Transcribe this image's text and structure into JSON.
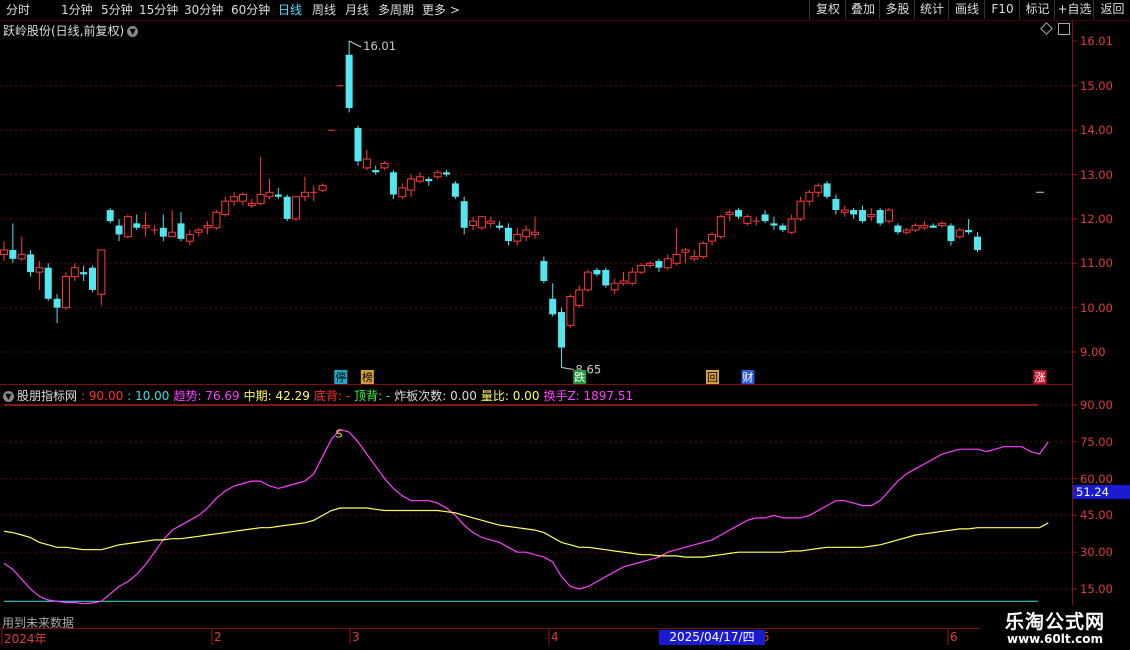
{
  "toolbar": {
    "left": [
      "分时",
      "1分钟",
      "5分钟",
      "15分钟",
      "30分钟",
      "60分钟",
      "日线",
      "周线",
      "月线",
      "多周期",
      "更多 >"
    ],
    "active": "日线",
    "right": [
      "复权",
      "叠加",
      "多股",
      "统计",
      "画线",
      "F10",
      "标记",
      "+自选",
      "返回"
    ]
  },
  "stock_header": {
    "title": "跃岭股份(日线,前复权)"
  },
  "price_axis": {
    "ticks": [
      "16.01",
      "15.00",
      "14.00",
      "13.00",
      "12.00",
      "11.00",
      "10.00",
      "9.00"
    ]
  },
  "annotations": {
    "high_label": "16.01",
    "low_label": "8.65",
    "markers": [
      {
        "label": "停",
        "color": "#1fa9c9",
        "text_color": "#000"
      },
      {
        "label": "榜",
        "color": "#d9a23a",
        "text_color": "#000"
      },
      {
        "label": "跌",
        "color": "#1f9a3a",
        "text_color": "#fff"
      },
      {
        "label": "回",
        "color": "#d9a23a",
        "text_color": "#000"
      },
      {
        "label": "财",
        "color": "#2a5bd8",
        "text_color": "#fff"
      },
      {
        "label": "涨",
        "color": "#c0162a",
        "text_color": "#fff"
      }
    ]
  },
  "indicator_header": {
    "name": "股朋指标网",
    "items": [
      {
        "text": ": 90.00",
        "color": "#ff3030"
      },
      {
        "text": ": 10.00",
        "color": "#40e0e0"
      },
      {
        "text": "趋势: 76.69",
        "color": "#ff40ff"
      },
      {
        "text": "中期: 42.29",
        "color": "#ffff60"
      },
      {
        "text": "底背: -",
        "color": "#ff3030"
      },
      {
        "text": "顶背: -",
        "color": "#40ff40"
      },
      {
        "text": "炸板次数: 0.00",
        "color": "#dddddd"
      },
      {
        "text": "量比: 0.00",
        "color": "#ffff60"
      },
      {
        "text": "换手Z: 1897.51",
        "color": "#ff40ff"
      }
    ]
  },
  "indicator_axis": {
    "ticks": [
      "90.00",
      "75.00",
      "60.00",
      "45.00",
      "30.00",
      "15.00"
    ]
  },
  "indicator_current_value": "51.24",
  "signal_label": "S",
  "future_note": "用到未来数据",
  "x_axis": {
    "labels": [
      "2024年",
      "2",
      "3",
      "4",
      "5",
      "6"
    ],
    "cursor_date": "2025/04/17/四"
  },
  "watermark": {
    "line1": "乐淘公式网",
    "line2": "www.60lt.com"
  },
  "chart_data": [
    {
      "type": "candlestick",
      "title": "跃岭股份(日线,前复权)",
      "ylim": [
        8.6,
        16.3
      ],
      "up_color": "#ff3a3a",
      "down_color": "#54e6f0",
      "ohlc": [
        [
          11.2,
          11.5,
          11.05,
          11.3
        ],
        [
          11.3,
          11.9,
          11.0,
          11.1
        ],
        [
          11.1,
          11.6,
          11.05,
          11.2
        ],
        [
          11.2,
          11.3,
          10.7,
          10.8
        ],
        [
          10.8,
          11.05,
          10.4,
          10.9
        ],
        [
          10.9,
          11.0,
          10.15,
          10.2
        ],
        [
          10.2,
          10.3,
          9.65,
          10.0
        ],
        [
          10.0,
          10.8,
          9.95,
          10.7
        ],
        [
          10.7,
          11.0,
          10.6,
          10.9
        ],
        [
          10.8,
          10.95,
          10.6,
          10.75
        ],
        [
          10.9,
          10.95,
          10.35,
          10.4
        ],
        [
          10.3,
          11.3,
          10.05,
          11.3
        ],
        [
          12.2,
          12.25,
          11.9,
          11.95
        ],
        [
          11.85,
          12.0,
          11.5,
          11.65
        ],
        [
          11.6,
          12.1,
          11.55,
          12.05
        ],
        [
          11.9,
          12.1,
          11.75,
          11.8
        ],
        [
          11.8,
          12.15,
          11.6,
          11.85
        ],
        [
          11.75,
          11.85,
          11.65,
          11.75
        ],
        [
          11.8,
          12.1,
          11.5,
          11.6
        ],
        [
          11.6,
          12.2,
          11.65,
          11.7
        ],
        [
          11.9,
          12.15,
          11.5,
          11.55
        ],
        [
          11.5,
          11.75,
          11.4,
          11.65
        ],
        [
          11.7,
          11.8,
          11.6,
          11.75
        ],
        [
          11.8,
          11.95,
          11.65,
          11.85
        ],
        [
          11.8,
          12.2,
          11.75,
          12.15
        ],
        [
          12.1,
          12.5,
          12.05,
          12.4
        ],
        [
          12.4,
          12.6,
          12.3,
          12.5
        ],
        [
          12.4,
          12.6,
          12.3,
          12.55
        ],
        [
          12.3,
          12.45,
          12.25,
          12.35
        ],
        [
          12.35,
          13.4,
          12.3,
          12.55
        ],
        [
          12.5,
          12.9,
          12.45,
          12.6
        ],
        [
          12.55,
          12.7,
          12.45,
          12.5
        ],
        [
          12.5,
          12.55,
          11.95,
          12.0
        ],
        [
          12.0,
          12.5,
          11.95,
          12.5
        ],
        [
          12.5,
          12.95,
          12.4,
          12.6
        ],
        [
          12.6,
          12.75,
          12.4,
          12.6
        ],
        [
          12.65,
          12.8,
          12.6,
          12.75
        ],
        [
          14.0,
          14.0,
          14.0,
          14.0
        ],
        [
          15.0,
          15.0,
          15.0,
          15.0
        ],
        [
          15.7,
          16.01,
          14.4,
          14.5
        ],
        [
          14.05,
          14.1,
          13.2,
          13.3
        ],
        [
          13.15,
          13.55,
          13.1,
          13.35
        ],
        [
          13.1,
          13.2,
          13.0,
          13.05
        ],
        [
          13.15,
          13.3,
          13.1,
          13.25
        ],
        [
          13.05,
          13.1,
          12.45,
          12.55
        ],
        [
          12.5,
          12.8,
          12.45,
          12.7
        ],
        [
          12.65,
          13.0,
          12.5,
          12.9
        ],
        [
          12.85,
          13.05,
          12.8,
          12.95
        ],
        [
          12.9,
          12.95,
          12.75,
          12.85
        ],
        [
          12.95,
          13.1,
          12.9,
          13.05
        ],
        [
          13.05,
          13.1,
          12.95,
          13.0
        ],
        [
          12.8,
          12.85,
          12.45,
          12.5
        ],
        [
          12.4,
          12.5,
          11.65,
          11.8
        ],
        [
          11.85,
          12.05,
          11.75,
          11.95
        ],
        [
          11.8,
          12.0,
          11.75,
          12.05
        ],
        [
          11.9,
          12.05,
          11.8,
          11.95
        ],
        [
          11.85,
          11.95,
          11.75,
          11.8
        ],
        [
          11.8,
          11.9,
          11.4,
          11.5
        ],
        [
          11.5,
          11.8,
          11.4,
          11.65
        ],
        [
          11.6,
          11.85,
          11.5,
          11.75
        ],
        [
          11.65,
          12.05,
          11.55,
          11.7
        ],
        [
          11.05,
          11.15,
          10.55,
          10.6
        ],
        [
          10.2,
          10.55,
          9.8,
          9.85
        ],
        [
          9.9,
          10.0,
          8.65,
          9.1
        ],
        [
          9.6,
          10.3,
          9.55,
          10.25
        ],
        [
          10.05,
          10.5,
          10.0,
          10.4
        ],
        [
          10.4,
          10.85,
          10.35,
          10.8
        ],
        [
          10.85,
          10.9,
          10.7,
          10.75
        ],
        [
          10.85,
          10.9,
          10.45,
          10.5
        ],
        [
          10.4,
          10.65,
          10.3,
          10.55
        ],
        [
          10.55,
          10.8,
          10.5,
          10.6
        ],
        [
          10.55,
          10.9,
          10.5,
          10.8
        ],
        [
          10.8,
          11.0,
          10.75,
          10.95
        ],
        [
          10.95,
          11.05,
          10.9,
          11.0
        ],
        [
          11.05,
          11.1,
          10.8,
          10.9
        ],
        [
          10.9,
          11.2,
          10.85,
          11.1
        ],
        [
          11.0,
          11.8,
          10.95,
          11.2
        ],
        [
          11.25,
          11.35,
          11.0,
          11.3
        ],
        [
          11.1,
          11.3,
          11.05,
          11.15
        ],
        [
          11.15,
          11.5,
          11.1,
          11.45
        ],
        [
          11.5,
          11.7,
          11.4,
          11.65
        ],
        [
          11.6,
          12.1,
          11.55,
          12.05
        ],
        [
          12.1,
          12.2,
          11.95,
          12.15
        ],
        [
          12.2,
          12.25,
          12.0,
          12.05
        ],
        [
          11.9,
          12.1,
          11.85,
          12.05
        ],
        [
          11.95,
          12.05,
          11.85,
          11.95
        ],
        [
          12.1,
          12.2,
          11.9,
          11.95
        ],
        [
          11.9,
          12.05,
          11.75,
          11.85
        ],
        [
          11.85,
          11.9,
          11.7,
          11.75
        ],
        [
          11.7,
          12.1,
          11.65,
          12.0
        ],
        [
          12.0,
          12.5,
          11.95,
          12.4
        ],
        [
          12.4,
          12.65,
          12.3,
          12.6
        ],
        [
          12.6,
          12.8,
          12.5,
          12.75
        ],
        [
          12.8,
          12.85,
          12.45,
          12.5
        ],
        [
          12.45,
          12.55,
          12.1,
          12.2
        ],
        [
          12.15,
          12.3,
          12.05,
          12.2
        ],
        [
          12.2,
          12.25,
          12.0,
          12.1
        ],
        [
          12.2,
          12.3,
          11.9,
          11.95
        ],
        [
          12.05,
          12.25,
          11.95,
          12.1
        ],
        [
          12.2,
          12.25,
          11.85,
          11.9
        ],
        [
          11.95,
          12.25,
          11.9,
          12.2
        ],
        [
          11.85,
          11.9,
          11.65,
          11.7
        ],
        [
          11.7,
          11.8,
          11.65,
          11.75
        ],
        [
          11.75,
          11.9,
          11.7,
          11.85
        ],
        [
          11.8,
          11.95,
          11.75,
          11.85
        ],
        [
          11.85,
          11.9,
          11.8,
          11.8
        ],
        [
          11.85,
          11.95,
          11.8,
          11.9
        ],
        [
          11.85,
          11.9,
          11.4,
          11.5
        ],
        [
          11.6,
          11.8,
          11.55,
          11.75
        ],
        [
          11.75,
          12.0,
          11.65,
          11.7
        ],
        [
          11.6,
          11.7,
          11.25,
          11.3
        ]
      ]
    },
    {
      "type": "line",
      "title": "股朋指标网",
      "ylim": [
        11,
        97
      ],
      "x_range": [
        1,
        119
      ],
      "series": [
        {
          "name": "趋势",
          "color": "#ff40ff",
          "values": [
            25.5,
            23,
            19,
            15,
            12,
            10.5,
            10,
            9.5,
            9.5,
            9,
            9.3,
            10,
            13,
            16,
            18,
            21,
            25,
            30,
            35,
            39,
            41,
            43,
            45,
            48,
            52,
            55,
            57,
            58,
            59,
            59,
            57,
            56,
            57,
            58,
            59,
            62,
            69,
            76,
            80,
            79,
            75,
            70,
            65,
            60,
            56,
            53,
            51,
            51,
            51,
            50,
            48,
            45,
            41,
            38,
            36,
            35,
            34,
            32,
            30,
            30,
            29,
            28,
            26,
            20,
            16,
            15,
            16,
            18,
            20,
            22,
            24,
            25,
            26,
            27,
            28,
            30,
            31,
            32,
            33,
            34,
            35,
            37,
            39,
            41,
            43,
            44,
            44,
            45,
            44,
            44,
            44,
            45,
            47,
            49,
            51,
            51,
            50,
            49,
            49,
            51,
            55,
            59,
            62,
            64,
            66,
            68,
            70,
            71,
            72,
            72,
            72,
            71,
            72,
            73,
            73,
            73,
            71,
            70,
            75
          ]
        },
        {
          "name": "中期",
          "color": "#ffff60",
          "values": [
            38.5,
            38,
            37,
            36,
            34,
            33,
            32,
            32,
            31.5,
            31,
            31,
            31,
            32,
            33,
            33.5,
            34,
            34.5,
            35,
            35,
            35.5,
            35.5,
            36,
            36.5,
            37,
            37.5,
            38,
            38.5,
            39,
            39.5,
            40,
            40,
            40.5,
            41,
            41.5,
            42,
            43,
            45,
            47,
            48,
            48,
            48,
            48,
            47.5,
            47,
            47,
            47,
            47,
            47,
            47,
            47,
            46.5,
            46,
            45,
            44,
            43,
            42,
            41,
            40.5,
            40,
            39.5,
            39,
            38,
            36,
            34,
            33,
            32,
            32,
            31.5,
            31,
            30.5,
            30,
            29.5,
            29,
            29,
            28.5,
            28.5,
            28.5,
            28,
            28,
            28,
            28.5,
            29,
            29.5,
            30,
            30,
            30,
            30,
            30,
            30,
            30.5,
            30.5,
            31,
            31.5,
            32,
            32,
            32,
            32,
            32,
            32.5,
            33,
            34,
            35,
            36,
            37,
            37.5,
            38,
            38.5,
            39,
            39.5,
            39.5,
            40,
            40,
            40,
            40,
            40,
            40,
            40,
            40,
            42
          ]
        }
      ],
      "hlines": [
        {
          "value": 90,
          "color": "#ff3030"
        },
        {
          "value": 10,
          "color": "#40e0e0"
        }
      ],
      "signal": {
        "label": "S",
        "index": 37
      }
    }
  ]
}
